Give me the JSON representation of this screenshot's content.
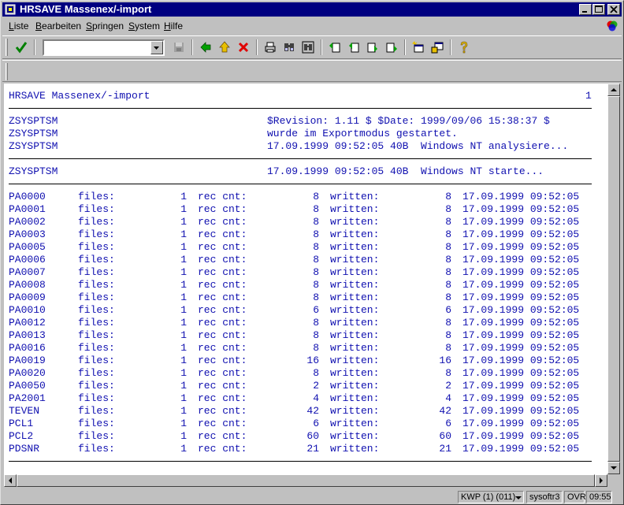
{
  "window": {
    "title": "HRSAVE Massenex/-import"
  },
  "menu": [
    {
      "label": "Liste"
    },
    {
      "label": "Bearbeiten"
    },
    {
      "label": "Springen"
    },
    {
      "label": "System"
    },
    {
      "label": "Hilfe"
    }
  ],
  "command_field": {
    "value": ""
  },
  "toolbar_icons": [
    "check-icon",
    "save-icon",
    "back-icon",
    "exit-icon",
    "cancel-icon",
    "print-icon",
    "find-icon",
    "find-next-icon",
    "first-page-icon",
    "previous-page-icon",
    "next-page-icon",
    "last-page-icon",
    "create-session-icon",
    "shortcut-icon",
    "help-icon"
  ],
  "report": {
    "header": {
      "title": "HRSAVE Massenex/-import",
      "page": "1"
    },
    "info_rows": [
      {
        "name": "ZSYSPTSM",
        "text": "$Revision: 1.11 $ $Date: 1999/09/06 15:38:37 $"
      },
      {
        "name": "ZSYSPTSM",
        "text": "wurde im Exportmodus gestartet."
      },
      {
        "name": "ZSYSPTSM",
        "text": "17.09.1999 09:52:05 40B  Windows NT analysiere..."
      }
    ],
    "start_row": {
      "name": "ZSYSPTSM",
      "text": "17.09.1999 09:52:05 40B  Windows NT starte..."
    },
    "labels": {
      "files": "files:",
      "rec_cnt": "rec cnt:",
      "written": "written:"
    },
    "rows": [
      {
        "table": "PA0000",
        "files": "1",
        "rec_cnt": "8",
        "written": "8",
        "timestamp": "17.09.1999 09:52:05"
      },
      {
        "table": "PA0001",
        "files": "1",
        "rec_cnt": "8",
        "written": "8",
        "timestamp": "17.09.1999 09:52:05"
      },
      {
        "table": "PA0002",
        "files": "1",
        "rec_cnt": "8",
        "written": "8",
        "timestamp": "17.09.1999 09:52:05"
      },
      {
        "table": "PA0003",
        "files": "1",
        "rec_cnt": "8",
        "written": "8",
        "timestamp": "17.09.1999 09:52:05"
      },
      {
        "table": "PA0005",
        "files": "1",
        "rec_cnt": "8",
        "written": "8",
        "timestamp": "17.09.1999 09:52:05"
      },
      {
        "table": "PA0006",
        "files": "1",
        "rec_cnt": "8",
        "written": "8",
        "timestamp": "17.09.1999 09:52:05"
      },
      {
        "table": "PA0007",
        "files": "1",
        "rec_cnt": "8",
        "written": "8",
        "timestamp": "17.09.1999 09:52:05"
      },
      {
        "table": "PA0008",
        "files": "1",
        "rec_cnt": "8",
        "written": "8",
        "timestamp": "17.09.1999 09:52:05"
      },
      {
        "table": "PA0009",
        "files": "1",
        "rec_cnt": "8",
        "written": "8",
        "timestamp": "17.09.1999 09:52:05"
      },
      {
        "table": "PA0010",
        "files": "1",
        "rec_cnt": "6",
        "written": "6",
        "timestamp": "17.09.1999 09:52:05"
      },
      {
        "table": "PA0012",
        "files": "1",
        "rec_cnt": "8",
        "written": "8",
        "timestamp": "17.09.1999 09:52:05"
      },
      {
        "table": "PA0013",
        "files": "1",
        "rec_cnt": "8",
        "written": "8",
        "timestamp": "17.09.1999 09:52:05"
      },
      {
        "table": "PA0016",
        "files": "1",
        "rec_cnt": "8",
        "written": "8",
        "timestamp": "17.09.1999 09:52:05"
      },
      {
        "table": "PA0019",
        "files": "1",
        "rec_cnt": "16",
        "written": "16",
        "timestamp": "17.09.1999 09:52:05"
      },
      {
        "table": "PA0020",
        "files": "1",
        "rec_cnt": "8",
        "written": "8",
        "timestamp": "17.09.1999 09:52:05"
      },
      {
        "table": "PA0050",
        "files": "1",
        "rec_cnt": "2",
        "written": "2",
        "timestamp": "17.09.1999 09:52:05"
      },
      {
        "table": "PA2001",
        "files": "1",
        "rec_cnt": "4",
        "written": "4",
        "timestamp": "17.09.1999 09:52:05"
      },
      {
        "table": "TEVEN",
        "files": "1",
        "rec_cnt": "42",
        "written": "42",
        "timestamp": "17.09.1999 09:52:05"
      },
      {
        "table": "PCL1",
        "files": "1",
        "rec_cnt": "6",
        "written": "6",
        "timestamp": "17.09.1999 09:52:05"
      },
      {
        "table": "PCL2",
        "files": "1",
        "rec_cnt": "60",
        "written": "60",
        "timestamp": "17.09.1999 09:52:05"
      },
      {
        "table": "PDSNR",
        "files": "1",
        "rec_cnt": "21",
        "written": "21",
        "timestamp": "17.09.1999 09:52:05"
      }
    ]
  },
  "status": {
    "system": "KWP (1) (011)",
    "server": "sysoftr3",
    "mode": "OVR",
    "time": "09:55"
  }
}
